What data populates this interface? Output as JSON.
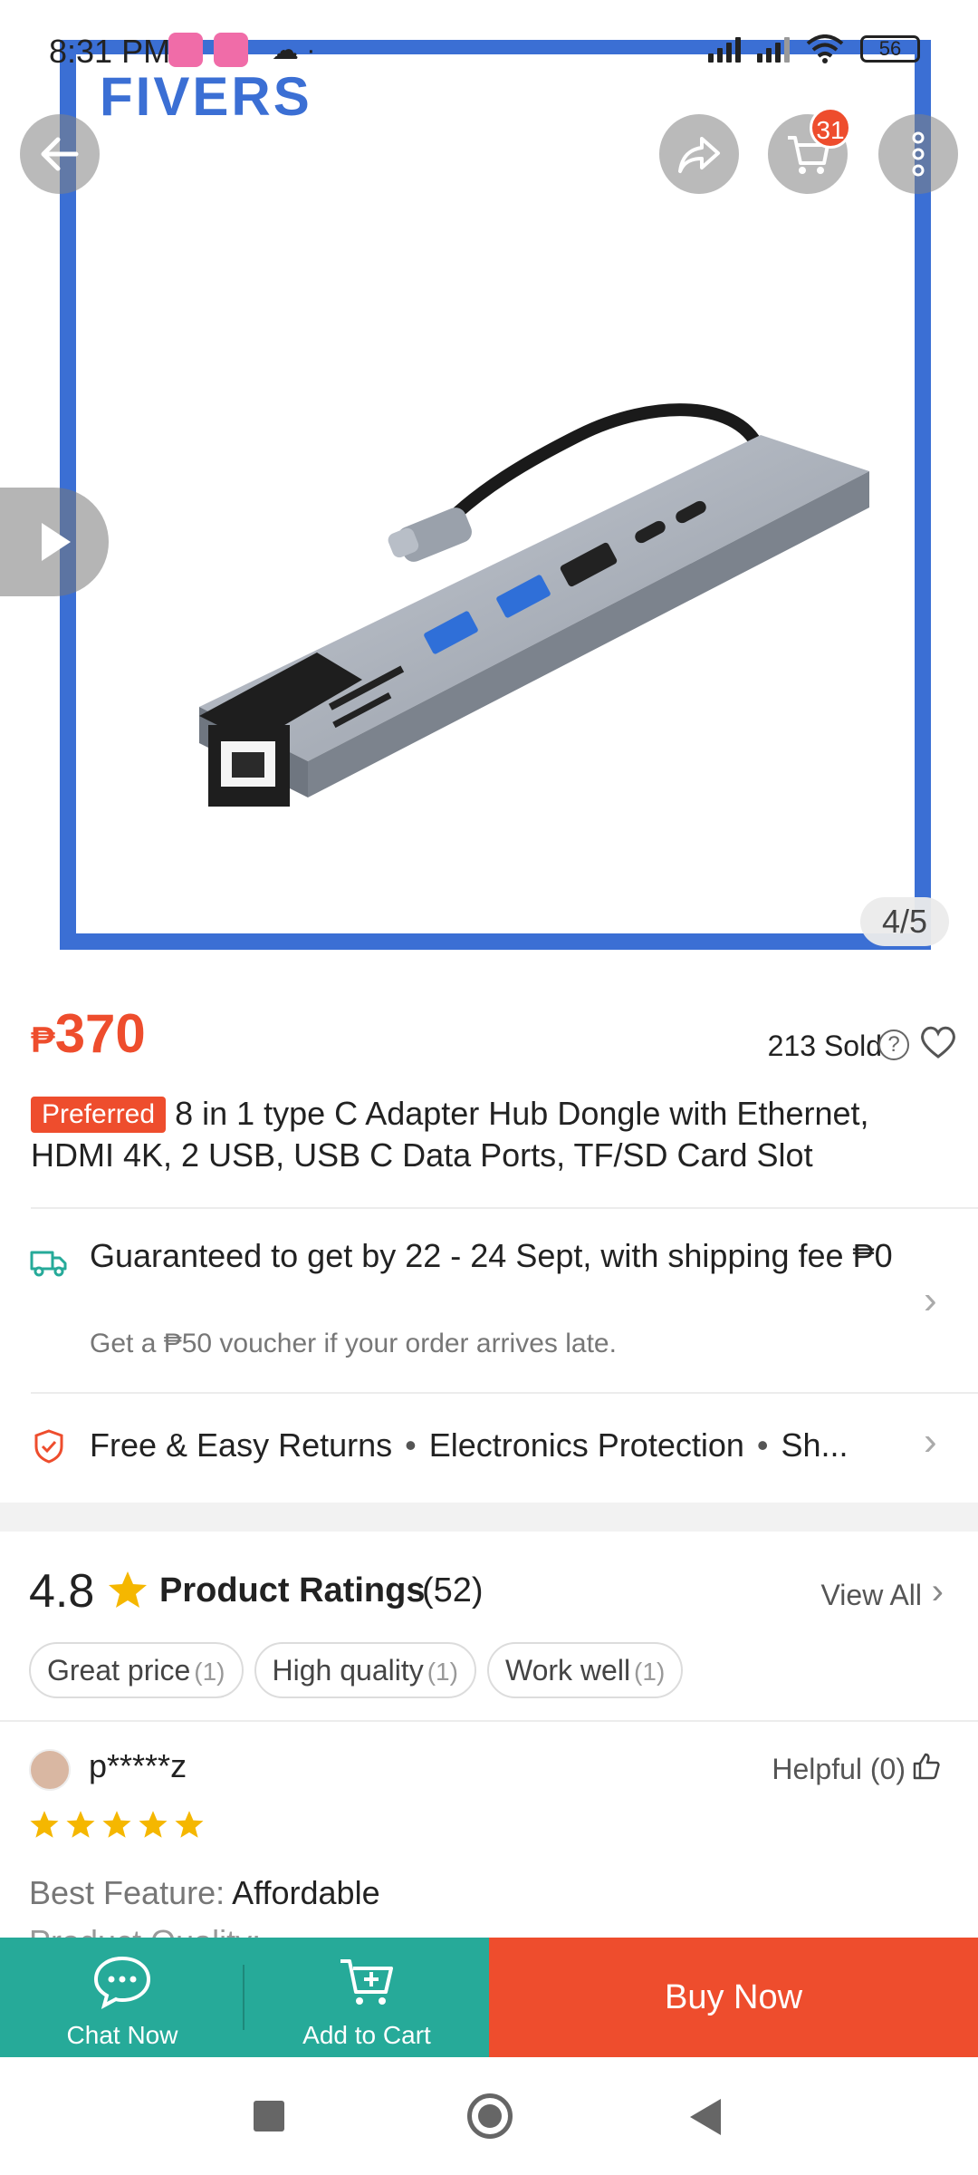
{
  "status_bar": {
    "time": "8:31 PM",
    "battery": "56"
  },
  "hero": {
    "brand": "FIVERS",
    "image_counter": "4/5",
    "cart_badge": "31"
  },
  "product": {
    "currency": "₱",
    "price": "370",
    "sold": "213 Sold",
    "badge": "Preferred",
    "title": "8 in 1 type C Adapter Hub Dongle with Ethernet, HDMI 4K, 2 USB, USB C Data Ports, TF/SD Card Slot"
  },
  "shipping": {
    "main": "Guaranteed to get by 22 - 24 Sept, with shipping fee ₱0",
    "sub": "Get a ₱50 voucher if your order arrives late."
  },
  "returns": {
    "items": [
      "Free & Easy Returns",
      "Electronics Protection",
      "Sh..."
    ]
  },
  "ratings": {
    "score": "4.8",
    "title": "Product Ratings",
    "count": "(52)",
    "view_all": "View All",
    "tags": [
      {
        "label": "Great price",
        "count": "(1)"
      },
      {
        "label": "High quality",
        "count": "(1)"
      },
      {
        "label": "Work well",
        "count": "(1)"
      }
    ]
  },
  "review": {
    "reviewer": "p*****z",
    "helpful": "Helpful (0)",
    "stars": 5,
    "feature_label": "Best Feature:",
    "feature_value": "Affordable",
    "feature2": "Product Quality:"
  },
  "actions": {
    "chat": "Chat Now",
    "add_to_cart": "Add to Cart",
    "buy_now": "Buy Now"
  },
  "colors": {
    "accent": "#ee4d2d",
    "teal": "#26aa99",
    "frame_blue": "#3b6fd4",
    "star": "#f5b700"
  }
}
